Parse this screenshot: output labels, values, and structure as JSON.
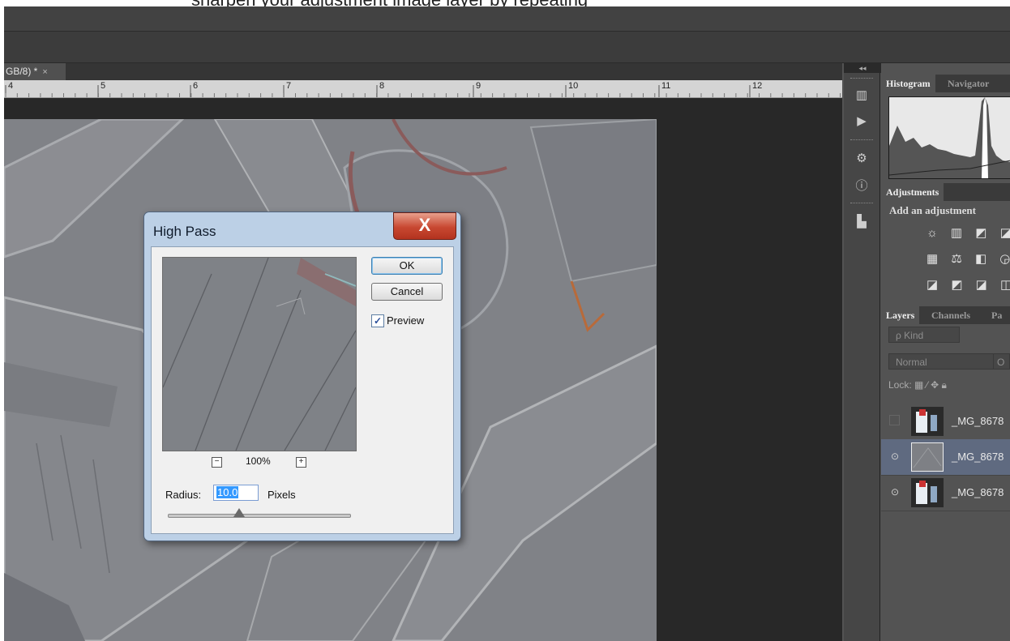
{
  "top_strip_text": "sharpen your adjustment image layer by repeating",
  "document_tab": {
    "title": "GB/8) *",
    "close": "×"
  },
  "ruler": {
    "labels": [
      "4",
      "5",
      "6",
      "7",
      "8",
      "9",
      "10",
      "11",
      "12"
    ]
  },
  "icon_bar": {
    "collapse": "◂◂"
  },
  "panels": {
    "histogram_tabs": [
      "Histogram",
      "Navigator"
    ],
    "adjustments_tab": "Adjustments",
    "adjustments_heading": "Add an adjustment",
    "adjustment_rows": [
      "☼ ▥ ◩ ◪",
      "▦ ⚖ ◧ ◶",
      "◪ ◩ ◪ ◫"
    ],
    "layers_tabs": [
      "Layers",
      "Channels",
      "Pa"
    ],
    "kind_filter": "ρ Kind",
    "blend_mode": "Normal",
    "opacity_short": "O",
    "lock_label": "Lock:",
    "layers": [
      {
        "name": "_MG_8678",
        "visible": false,
        "selected": false
      },
      {
        "name": "_MG_8678",
        "visible": true,
        "selected": true
      },
      {
        "name": "_MG_8678",
        "visible": true,
        "selected": false
      }
    ]
  },
  "dialog": {
    "title": "High Pass",
    "close_glyph": "X",
    "ok_label": "OK",
    "cancel_label": "Cancel",
    "preview_label": "Preview",
    "preview_checked": true,
    "zoom_minus": "−",
    "zoom_plus": "+",
    "zoom_level": "100%",
    "radius_label": "Radius:",
    "radius_value": "10.0",
    "units_label": "Pixels"
  }
}
